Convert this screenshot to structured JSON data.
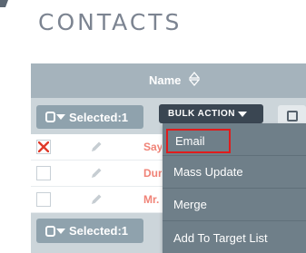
{
  "page": {
    "title": "CONTACTS"
  },
  "table": {
    "column_name": "Name",
    "toolbar": {
      "selected_label": "Selected:1",
      "bulk_action_label": "BULK ACTION"
    },
    "rows": [
      {
        "checked": true,
        "name_fragment": "Say"
      },
      {
        "checked": false,
        "name_fragment": "Dur"
      },
      {
        "checked": false,
        "name_fragment": "Mr."
      }
    ],
    "bottom_toolbar": {
      "selected_label": "Selected:1"
    }
  },
  "bulk_menu": {
    "items": [
      {
        "label": "Email",
        "highlighted": true
      },
      {
        "label": "Mass Update"
      },
      {
        "label": "Merge"
      },
      {
        "label": "Add To Target List"
      }
    ]
  },
  "colors": {
    "header_bg": "#a5b3bc",
    "toolbar_bg": "#ccd5da",
    "bulk_button_bg": "#3a4652",
    "menu_bg": "#6f7f89",
    "link_color": "#f08377",
    "highlight_border": "#e01c1c"
  },
  "icons": {
    "checkbox_checked": "x-mark-icon",
    "edit": "pencil-icon",
    "sort": "sort-arrows-icon",
    "columns": "column-chooser-icon"
  }
}
